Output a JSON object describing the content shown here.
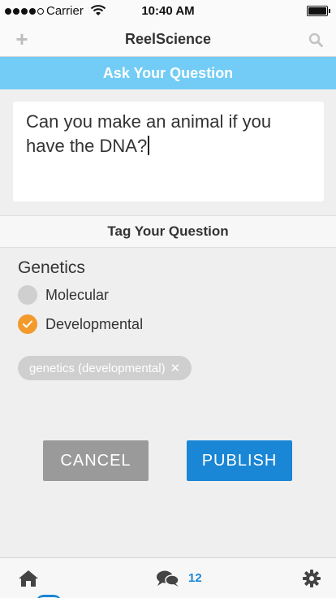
{
  "status_bar": {
    "carrier": "Carrier",
    "time": "10:40 AM",
    "signal_bars": 5,
    "signal_filled": 4
  },
  "nav": {
    "title": "ReelScience",
    "left_icon": "plus-icon",
    "right_icon": "search-icon"
  },
  "ask_header": "Ask Your Question",
  "question": {
    "text": "Can you make an animal if you have the DNA?"
  },
  "tag_header": "Tag Your Question",
  "category": {
    "title": "Genetics",
    "options": [
      {
        "label": "Molecular",
        "checked": false
      },
      {
        "label": "Developmental",
        "checked": true
      }
    ]
  },
  "selected_tag": {
    "label": "genetics (developmental)"
  },
  "buttons": {
    "cancel": "CANCEL",
    "publish": "PUBLISH"
  },
  "tab_bar": {
    "message_count": "12",
    "icons": [
      "home-icon",
      "chat-icon",
      "gear-icon"
    ]
  },
  "colors": {
    "accent_blue": "#1a86d6",
    "header_blue": "#72ccf6",
    "checked_orange": "#f39a2c",
    "cancel_gray": "#9a9a9a"
  }
}
